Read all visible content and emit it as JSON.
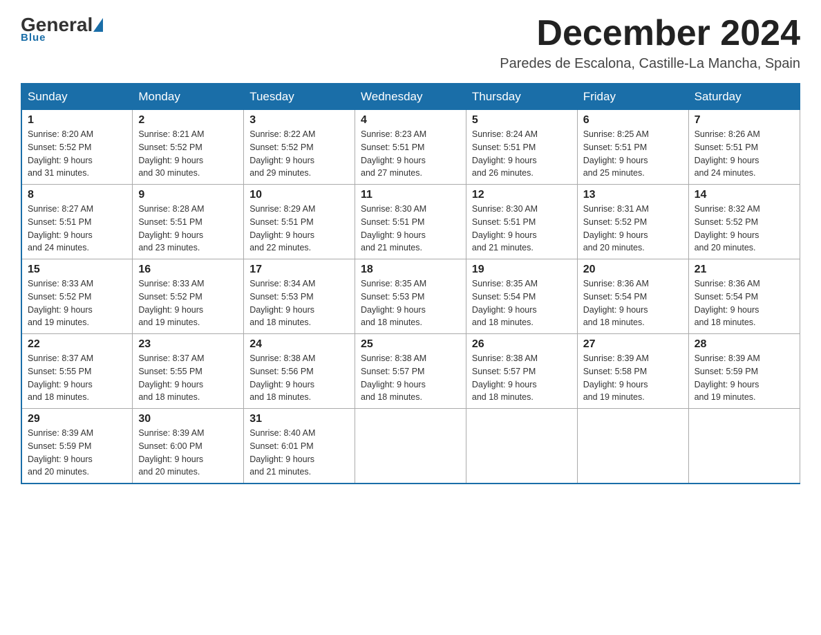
{
  "header": {
    "logo_general": "General",
    "logo_blue": "Blue",
    "title": "December 2024",
    "subtitle": "Paredes de Escalona, Castille-La Mancha, Spain"
  },
  "calendar": {
    "days_of_week": [
      "Sunday",
      "Monday",
      "Tuesday",
      "Wednesday",
      "Thursday",
      "Friday",
      "Saturday"
    ],
    "weeks": [
      [
        {
          "day": "1",
          "info": "Sunrise: 8:20 AM\nSunset: 5:52 PM\nDaylight: 9 hours\nand 31 minutes."
        },
        {
          "day": "2",
          "info": "Sunrise: 8:21 AM\nSunset: 5:52 PM\nDaylight: 9 hours\nand 30 minutes."
        },
        {
          "day": "3",
          "info": "Sunrise: 8:22 AM\nSunset: 5:52 PM\nDaylight: 9 hours\nand 29 minutes."
        },
        {
          "day": "4",
          "info": "Sunrise: 8:23 AM\nSunset: 5:51 PM\nDaylight: 9 hours\nand 27 minutes."
        },
        {
          "day": "5",
          "info": "Sunrise: 8:24 AM\nSunset: 5:51 PM\nDaylight: 9 hours\nand 26 minutes."
        },
        {
          "day": "6",
          "info": "Sunrise: 8:25 AM\nSunset: 5:51 PM\nDaylight: 9 hours\nand 25 minutes."
        },
        {
          "day": "7",
          "info": "Sunrise: 8:26 AM\nSunset: 5:51 PM\nDaylight: 9 hours\nand 24 minutes."
        }
      ],
      [
        {
          "day": "8",
          "info": "Sunrise: 8:27 AM\nSunset: 5:51 PM\nDaylight: 9 hours\nand 24 minutes."
        },
        {
          "day": "9",
          "info": "Sunrise: 8:28 AM\nSunset: 5:51 PM\nDaylight: 9 hours\nand 23 minutes."
        },
        {
          "day": "10",
          "info": "Sunrise: 8:29 AM\nSunset: 5:51 PM\nDaylight: 9 hours\nand 22 minutes."
        },
        {
          "day": "11",
          "info": "Sunrise: 8:30 AM\nSunset: 5:51 PM\nDaylight: 9 hours\nand 21 minutes."
        },
        {
          "day": "12",
          "info": "Sunrise: 8:30 AM\nSunset: 5:51 PM\nDaylight: 9 hours\nand 21 minutes."
        },
        {
          "day": "13",
          "info": "Sunrise: 8:31 AM\nSunset: 5:52 PM\nDaylight: 9 hours\nand 20 minutes."
        },
        {
          "day": "14",
          "info": "Sunrise: 8:32 AM\nSunset: 5:52 PM\nDaylight: 9 hours\nand 20 minutes."
        }
      ],
      [
        {
          "day": "15",
          "info": "Sunrise: 8:33 AM\nSunset: 5:52 PM\nDaylight: 9 hours\nand 19 minutes."
        },
        {
          "day": "16",
          "info": "Sunrise: 8:33 AM\nSunset: 5:52 PM\nDaylight: 9 hours\nand 19 minutes."
        },
        {
          "day": "17",
          "info": "Sunrise: 8:34 AM\nSunset: 5:53 PM\nDaylight: 9 hours\nand 18 minutes."
        },
        {
          "day": "18",
          "info": "Sunrise: 8:35 AM\nSunset: 5:53 PM\nDaylight: 9 hours\nand 18 minutes."
        },
        {
          "day": "19",
          "info": "Sunrise: 8:35 AM\nSunset: 5:54 PM\nDaylight: 9 hours\nand 18 minutes."
        },
        {
          "day": "20",
          "info": "Sunrise: 8:36 AM\nSunset: 5:54 PM\nDaylight: 9 hours\nand 18 minutes."
        },
        {
          "day": "21",
          "info": "Sunrise: 8:36 AM\nSunset: 5:54 PM\nDaylight: 9 hours\nand 18 minutes."
        }
      ],
      [
        {
          "day": "22",
          "info": "Sunrise: 8:37 AM\nSunset: 5:55 PM\nDaylight: 9 hours\nand 18 minutes."
        },
        {
          "day": "23",
          "info": "Sunrise: 8:37 AM\nSunset: 5:55 PM\nDaylight: 9 hours\nand 18 minutes."
        },
        {
          "day": "24",
          "info": "Sunrise: 8:38 AM\nSunset: 5:56 PM\nDaylight: 9 hours\nand 18 minutes."
        },
        {
          "day": "25",
          "info": "Sunrise: 8:38 AM\nSunset: 5:57 PM\nDaylight: 9 hours\nand 18 minutes."
        },
        {
          "day": "26",
          "info": "Sunrise: 8:38 AM\nSunset: 5:57 PM\nDaylight: 9 hours\nand 18 minutes."
        },
        {
          "day": "27",
          "info": "Sunrise: 8:39 AM\nSunset: 5:58 PM\nDaylight: 9 hours\nand 19 minutes."
        },
        {
          "day": "28",
          "info": "Sunrise: 8:39 AM\nSunset: 5:59 PM\nDaylight: 9 hours\nand 19 minutes."
        }
      ],
      [
        {
          "day": "29",
          "info": "Sunrise: 8:39 AM\nSunset: 5:59 PM\nDaylight: 9 hours\nand 20 minutes."
        },
        {
          "day": "30",
          "info": "Sunrise: 8:39 AM\nSunset: 6:00 PM\nDaylight: 9 hours\nand 20 minutes."
        },
        {
          "day": "31",
          "info": "Sunrise: 8:40 AM\nSunset: 6:01 PM\nDaylight: 9 hours\nand 21 minutes."
        },
        {
          "day": "",
          "info": ""
        },
        {
          "day": "",
          "info": ""
        },
        {
          "day": "",
          "info": ""
        },
        {
          "day": "",
          "info": ""
        }
      ]
    ]
  }
}
